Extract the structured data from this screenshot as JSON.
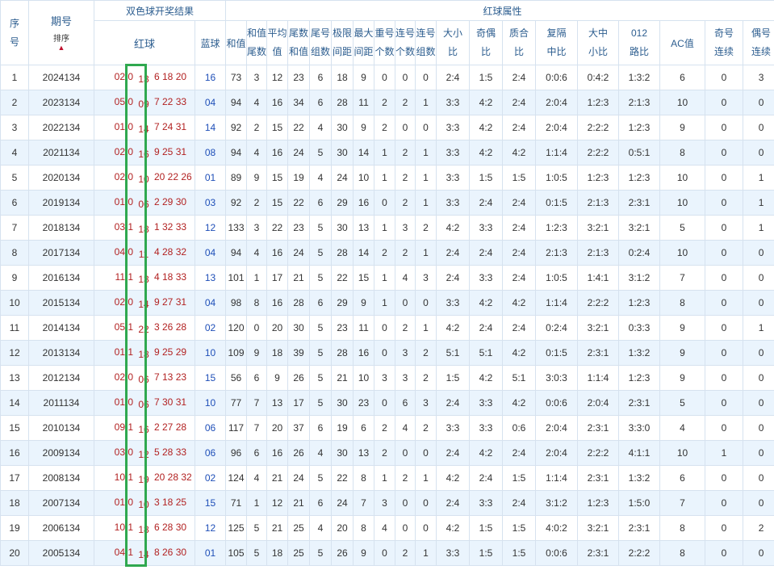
{
  "header": {
    "seq_a": "序",
    "seq_b": "号",
    "period": "期号",
    "sort_label": "排序",
    "sort_arrow": "▲",
    "draw_result": "双色球开奖结果",
    "red_attr": "红球属性",
    "red_ball": "红球",
    "blue_ball": "蓝球",
    "sum": "和值",
    "sum_tail_a": "和值",
    "sum_tail_b": "尾数",
    "avg_a": "平均",
    "avg_b": "值",
    "tail_sum_a": "尾数",
    "tail_sum_b": "和值",
    "tail_grp_a": "尾号",
    "tail_grp_b": "组数",
    "range_a": "极限",
    "range_b": "间距",
    "max_gap_a": "最大",
    "max_gap_b": "间距",
    "repeat_a": "重号",
    "repeat_b": "个数",
    "consec_a": "连号",
    "consec_b": "个数",
    "consec_grp_a": "连号",
    "consec_grp_b": "组数",
    "big_small_a": "大小",
    "big_small_b": "比",
    "odd_even_a": "奇偶",
    "odd_even_b": "比",
    "prime_a": "质合",
    "prime_b": "比",
    "rep_ratio_a": "复隔",
    "rep_ratio_b": "中比",
    "bms_a": "大中",
    "bms_b": "小比",
    "road_a": "012",
    "road_b": "路比",
    "ac": "AC值",
    "odd_run_a": "奇号",
    "odd_run_b": "连续",
    "even_run_a": "偶号",
    "even_run_b": "连续"
  },
  "rows": [
    {
      "no": "1",
      "period": "2024134",
      "rb": "02 0",
      "rh": "13",
      "rt": "6 18 20",
      "blue": "16",
      "sum": "73",
      "st": "3",
      "avg": "12",
      "ts": "23",
      "tg": "6",
      "rg": "18",
      "mg": "9",
      "rp": "0",
      "cn": "0",
      "cg": "0",
      "bs": "2:4",
      "oe": "1:5",
      "pc": "2:4",
      "rr": "0:0:6",
      "bm": "0:4:2",
      "rd": "1:3:2",
      "ac": "6",
      "odr": "0",
      "evr": "3"
    },
    {
      "no": "2",
      "period": "2023134",
      "rb": "05 0",
      "rh": "09",
      "rt": "7 22 33",
      "blue": "04",
      "sum": "94",
      "st": "4",
      "avg": "16",
      "ts": "34",
      "tg": "6",
      "rg": "28",
      "mg": "11",
      "rp": "2",
      "cn": "2",
      "cg": "1",
      "bs": "3:3",
      "oe": "4:2",
      "pc": "2:4",
      "rr": "2:0:4",
      "bm": "1:2:3",
      "rd": "2:1:3",
      "ac": "10",
      "odr": "0",
      "evr": "0"
    },
    {
      "no": "3",
      "period": "2022134",
      "rb": "01 0",
      "rh": "14",
      "rt": "7 24 31",
      "blue": "14",
      "sum": "92",
      "st": "2",
      "avg": "15",
      "ts": "22",
      "tg": "4",
      "rg": "30",
      "mg": "9",
      "rp": "2",
      "cn": "0",
      "cg": "0",
      "bs": "3:3",
      "oe": "4:2",
      "pc": "2:4",
      "rr": "2:0:4",
      "bm": "2:2:2",
      "rd": "1:2:3",
      "ac": "9",
      "odr": "0",
      "evr": "0"
    },
    {
      "no": "4",
      "period": "2021134",
      "rb": "02 0",
      "rh": "16",
      "rt": "9 25 31",
      "blue": "08",
      "sum": "94",
      "st": "4",
      "avg": "16",
      "ts": "24",
      "tg": "5",
      "rg": "30",
      "mg": "14",
      "rp": "1",
      "cn": "2",
      "cg": "1",
      "bs": "3:3",
      "oe": "4:2",
      "pc": "4:2",
      "rr": "1:1:4",
      "bm": "2:2:2",
      "rd": "0:5:1",
      "ac": "8",
      "odr": "0",
      "evr": "0"
    },
    {
      "no": "5",
      "period": "2020134",
      "rb": "02 0",
      "rh": "10",
      "rt": "20 22 26",
      "blue": "01",
      "sum": "89",
      "st": "9",
      "avg": "15",
      "ts": "19",
      "tg": "4",
      "rg": "24",
      "mg": "10",
      "rp": "1",
      "cn": "2",
      "cg": "1",
      "bs": "3:3",
      "oe": "1:5",
      "pc": "1:5",
      "rr": "1:0:5",
      "bm": "1:2:3",
      "rd": "1:2:3",
      "ac": "10",
      "odr": "0",
      "evr": "1"
    },
    {
      "no": "6",
      "period": "2019134",
      "rb": "01 0",
      "rh": "06",
      "rt": "2 29 30",
      "blue": "03",
      "sum": "92",
      "st": "2",
      "avg": "15",
      "ts": "22",
      "tg": "6",
      "rg": "29",
      "mg": "16",
      "rp": "0",
      "cn": "2",
      "cg": "1",
      "bs": "3:3",
      "oe": "2:4",
      "pc": "2:4",
      "rr": "0:1:5",
      "bm": "2:1:3",
      "rd": "2:3:1",
      "ac": "10",
      "odr": "0",
      "evr": "1"
    },
    {
      "no": "7",
      "period": "2018134",
      "rb": "03 1",
      "rh": "18",
      "rt": "1 32 33",
      "blue": "12",
      "sum": "133",
      "st": "3",
      "avg": "22",
      "ts": "23",
      "tg": "5",
      "rg": "30",
      "mg": "13",
      "rp": "1",
      "cn": "3",
      "cg": "2",
      "bs": "4:2",
      "oe": "3:3",
      "pc": "2:4",
      "rr": "1:2:3",
      "bm": "3:2:1",
      "rd": "3:2:1",
      "ac": "5",
      "odr": "0",
      "evr": "1"
    },
    {
      "no": "8",
      "period": "2017134",
      "rb": "04 0",
      "rh": "11",
      "rt": "4 28 32",
      "blue": "04",
      "sum": "94",
      "st": "4",
      "avg": "16",
      "ts": "24",
      "tg": "5",
      "rg": "28",
      "mg": "14",
      "rp": "2",
      "cn": "2",
      "cg": "1",
      "bs": "2:4",
      "oe": "2:4",
      "pc": "2:4",
      "rr": "2:1:3",
      "bm": "2:1:3",
      "rd": "0:2:4",
      "ac": "10",
      "odr": "0",
      "evr": "0"
    },
    {
      "no": "9",
      "period": "2016134",
      "rb": "11 1",
      "rh": "13",
      "rt": "4 18 33",
      "blue": "13",
      "sum": "101",
      "st": "1",
      "avg": "17",
      "ts": "21",
      "tg": "5",
      "rg": "22",
      "mg": "15",
      "rp": "1",
      "cn": "4",
      "cg": "3",
      "bs": "2:4",
      "oe": "3:3",
      "pc": "2:4",
      "rr": "1:0:5",
      "bm": "1:4:1",
      "rd": "3:1:2",
      "ac": "7",
      "odr": "0",
      "evr": "0"
    },
    {
      "no": "10",
      "period": "2015134",
      "rb": "02 0",
      "rh": "14",
      "rt": "9 27 31",
      "blue": "04",
      "sum": "98",
      "st": "8",
      "avg": "16",
      "ts": "28",
      "tg": "6",
      "rg": "29",
      "mg": "9",
      "rp": "1",
      "cn": "0",
      "cg": "0",
      "bs": "3:3",
      "oe": "4:2",
      "pc": "4:2",
      "rr": "1:1:4",
      "bm": "2:2:2",
      "rd": "1:2:3",
      "ac": "8",
      "odr": "0",
      "evr": "0"
    },
    {
      "no": "11",
      "period": "2014134",
      "rb": "05 1",
      "rh": "22",
      "rt": "3 26 28",
      "blue": "02",
      "sum": "120",
      "st": "0",
      "avg": "20",
      "ts": "30",
      "tg": "5",
      "rg": "23",
      "mg": "11",
      "rp": "0",
      "cn": "2",
      "cg": "1",
      "bs": "4:2",
      "oe": "2:4",
      "pc": "2:4",
      "rr": "0:2:4",
      "bm": "3:2:1",
      "rd": "0:3:3",
      "ac": "9",
      "odr": "0",
      "evr": "1"
    },
    {
      "no": "12",
      "period": "2013134",
      "rb": "01 1",
      "rh": "18",
      "rt": "9 25 29",
      "blue": "10",
      "sum": "109",
      "st": "9",
      "avg": "18",
      "ts": "39",
      "tg": "5",
      "rg": "28",
      "mg": "16",
      "rp": "0",
      "cn": "3",
      "cg": "2",
      "bs": "5:1",
      "oe": "5:1",
      "pc": "4:2",
      "rr": "0:1:5",
      "bm": "2:3:1",
      "rd": "1:3:2",
      "ac": "9",
      "odr": "0",
      "evr": "0"
    },
    {
      "no": "13",
      "period": "2012134",
      "rb": "02 0",
      "rh": "06",
      "rt": "7 13 23",
      "blue": "15",
      "sum": "56",
      "st": "6",
      "avg": "9",
      "ts": "26",
      "tg": "5",
      "rg": "21",
      "mg": "10",
      "rp": "3",
      "cn": "3",
      "cg": "2",
      "bs": "1:5",
      "oe": "4:2",
      "pc": "5:1",
      "rr": "3:0:3",
      "bm": "1:1:4",
      "rd": "1:2:3",
      "ac": "9",
      "odr": "0",
      "evr": "0"
    },
    {
      "no": "14",
      "period": "2011134",
      "rb": "01 0",
      "rh": "06",
      "rt": "7 30 31",
      "blue": "10",
      "sum": "77",
      "st": "7",
      "avg": "13",
      "ts": "17",
      "tg": "5",
      "rg": "30",
      "mg": "23",
      "rp": "0",
      "cn": "6",
      "cg": "3",
      "bs": "2:4",
      "oe": "3:3",
      "pc": "4:2",
      "rr": "0:0:6",
      "bm": "2:0:4",
      "rd": "2:3:1",
      "ac": "5",
      "odr": "0",
      "evr": "0"
    },
    {
      "no": "15",
      "period": "2010134",
      "rb": "09 1",
      "rh": "16",
      "rt": "2 27 28",
      "blue": "06",
      "sum": "117",
      "st": "7",
      "avg": "20",
      "ts": "37",
      "tg": "6",
      "rg": "19",
      "mg": "6",
      "rp": "2",
      "cn": "4",
      "cg": "2",
      "bs": "3:3",
      "oe": "3:3",
      "pc": "0:6",
      "rr": "2:0:4",
      "bm": "2:3:1",
      "rd": "3:3:0",
      "ac": "4",
      "odr": "0",
      "evr": "0"
    },
    {
      "no": "16",
      "period": "2009134",
      "rb": "03 0",
      "rh": "12",
      "rt": "5 28 33",
      "blue": "06",
      "sum": "96",
      "st": "6",
      "avg": "16",
      "ts": "26",
      "tg": "4",
      "rg": "30",
      "mg": "13",
      "rp": "2",
      "cn": "0",
      "cg": "0",
      "bs": "2:4",
      "oe": "4:2",
      "pc": "2:4",
      "rr": "2:0:4",
      "bm": "2:2:2",
      "rd": "4:1:1",
      "ac": "10",
      "odr": "1",
      "evr": "0"
    },
    {
      "no": "17",
      "period": "2008134",
      "rb": "10 1",
      "rh": "19",
      "rt": "20 28 32",
      "blue": "02",
      "sum": "124",
      "st": "4",
      "avg": "21",
      "ts": "24",
      "tg": "5",
      "rg": "22",
      "mg": "8",
      "rp": "1",
      "cn": "2",
      "cg": "1",
      "bs": "4:2",
      "oe": "2:4",
      "pc": "1:5",
      "rr": "1:1:4",
      "bm": "2:3:1",
      "rd": "1:3:2",
      "ac": "6",
      "odr": "0",
      "evr": "0"
    },
    {
      "no": "18",
      "period": "2007134",
      "rb": "01 0",
      "rh": "10",
      "rt": "3 18 25",
      "blue": "15",
      "sum": "71",
      "st": "1",
      "avg": "12",
      "ts": "21",
      "tg": "6",
      "rg": "24",
      "mg": "7",
      "rp": "3",
      "cn": "0",
      "cg": "0",
      "bs": "2:4",
      "oe": "3:3",
      "pc": "2:4",
      "rr": "3:1:2",
      "bm": "1:2:3",
      "rd": "1:5:0",
      "ac": "7",
      "odr": "0",
      "evr": "0"
    },
    {
      "no": "19",
      "period": "2006134",
      "rb": "10 1",
      "rh": "18",
      "rt": "6 28 30",
      "blue": "12",
      "sum": "125",
      "st": "5",
      "avg": "21",
      "ts": "25",
      "tg": "4",
      "rg": "20",
      "mg": "8",
      "rp": "4",
      "cn": "0",
      "cg": "0",
      "bs": "4:2",
      "oe": "1:5",
      "pc": "1:5",
      "rr": "4:0:2",
      "bm": "3:2:1",
      "rd": "2:3:1",
      "ac": "8",
      "odr": "0",
      "evr": "2"
    },
    {
      "no": "20",
      "period": "2005134",
      "rb": "04 1",
      "rh": "14",
      "rt": "8 26 30",
      "blue": "01",
      "sum": "105",
      "st": "5",
      "avg": "18",
      "ts": "25",
      "tg": "5",
      "rg": "26",
      "mg": "9",
      "rp": "0",
      "cn": "2",
      "cg": "1",
      "bs": "3:3",
      "oe": "1:5",
      "pc": "1:5",
      "rr": "0:0:6",
      "bm": "2:3:1",
      "rd": "2:2:2",
      "ac": "8",
      "odr": "0",
      "evr": "0"
    }
  ],
  "colors": {
    "highlight": "#2fa84f",
    "red_number": "#b22222",
    "blue_number": "#1f4fb8",
    "row_alt": "#eaf4fd",
    "header_text": "#2c5d8f"
  }
}
